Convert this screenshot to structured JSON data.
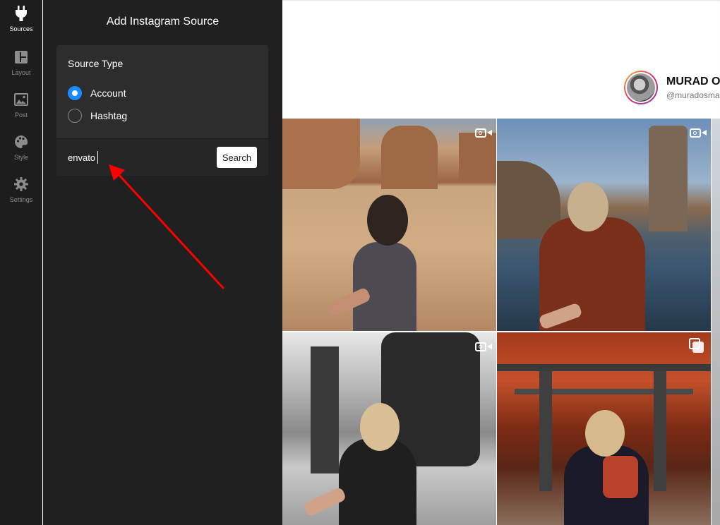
{
  "rail": {
    "items": [
      {
        "label": "Sources",
        "icon": "plug-icon",
        "active": true
      },
      {
        "label": "Layout",
        "icon": "layout-icon"
      },
      {
        "label": "Post",
        "icon": "image-icon"
      },
      {
        "label": "Style",
        "icon": "palette-icon"
      },
      {
        "label": "Settings",
        "icon": "gear-icon"
      }
    ]
  },
  "panel": {
    "title": "Add Instagram Source",
    "source_type_label": "Source Type",
    "options": [
      {
        "label": "Account",
        "checked": true
      },
      {
        "label": "Hashtag",
        "checked": false
      }
    ],
    "search": {
      "value": "envato",
      "button_label": "Search"
    }
  },
  "preview": {
    "profile": {
      "name": "MURAD O",
      "handle": "@muradosma"
    },
    "tiles": [
      {
        "media": "video"
      },
      {
        "media": "video"
      },
      {
        "media": "video"
      },
      {
        "media": "carousel"
      }
    ]
  },
  "colors": {
    "accent": "#1a8cff",
    "rail_bg": "#1d1d1d",
    "panel_bg": "#202020",
    "card_bg": "#2d2d2d",
    "annotation_arrow": "#ff0000"
  }
}
